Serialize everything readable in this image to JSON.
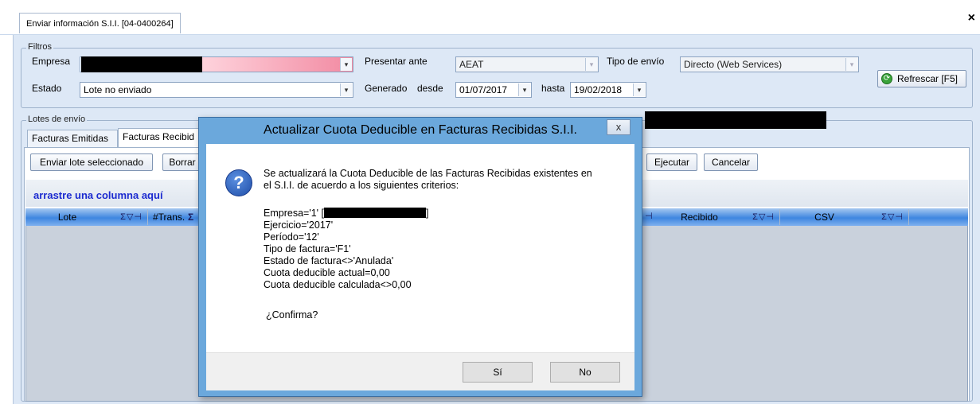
{
  "window": {
    "tab_title": "Enviar información S.I.I. [04-0400264]",
    "close_glyph": "×"
  },
  "filters": {
    "legend": "Filtros",
    "empresa_label": "Empresa",
    "empresa_value": "",
    "estado_label": "Estado",
    "estado_value": "Lote no enviado",
    "presentar_label": "Presentar ante",
    "presentar_value": "AEAT",
    "tipo_envio_label": "Tipo de envío",
    "tipo_envio_value": "Directo (Web Services)",
    "generado_label": "Generado",
    "desde_label": "desde",
    "desde_value": "01/07/2017",
    "hasta_label": "hasta",
    "hasta_value": "19/02/2018",
    "refresh_label": "Refrescar [F5]",
    "dropdown_glyph": "▾"
  },
  "batches": {
    "legend": "Lotes de envío",
    "tabs": [
      "Facturas Emitidas",
      "Facturas Recibid"
    ],
    "send_button": "Enviar lote seleccionado",
    "delete_button": "Borrar",
    "execute_button": "Ejecutar",
    "cancel_button": "Cancelar",
    "drag_hint": "arrastre una columna aquí",
    "columns": [
      {
        "label": "Lote",
        "icons": "Σ▽⊣"
      },
      {
        "label": "#Trans.",
        "icons": "Σ"
      },
      {
        "label": "Recibido",
        "icons": "Σ▽⊣"
      },
      {
        "label": "CSV",
        "icons": "Σ▽⊣"
      }
    ],
    "partial_col_icon": "⊣"
  },
  "dialog": {
    "title": "Actualizar Cuota Deducible en Facturas Recibidas S.I.I.",
    "close": "x",
    "icon": "?",
    "intro_line1": "Se actualizará la Cuota Deducible de las Facturas Recibidas existentes en",
    "intro_line2": "el S.I.I. de acuerdo a los siguientes criterios:",
    "criteria": {
      "empresa_prefix": "Empresa='1' [",
      "empresa_suffix": "]",
      "ejercicio": "Ejercicio='2017'",
      "periodo": "Período='12'",
      "tipo": "Tipo de factura='F1'",
      "estado": "Estado de factura<>'Anulada'",
      "cuota_actual": "Cuota deducible actual=0,00",
      "cuota_calculada": "Cuota deducible calculada<>0,00"
    },
    "confirm": "¿Confirma?",
    "yes_button": "Sí",
    "no_button": "No"
  }
}
